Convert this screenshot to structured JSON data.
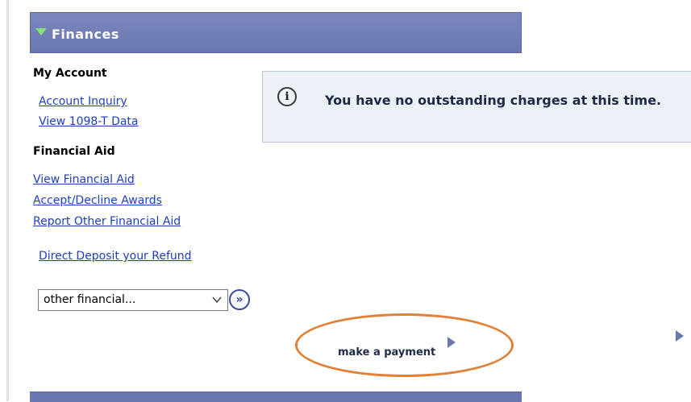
{
  "section": {
    "title": "Finances"
  },
  "my_account": {
    "heading": "My Account",
    "links": [
      "Account Inquiry",
      "View 1098-T Data"
    ]
  },
  "financial_aid": {
    "heading": "Financial Aid",
    "links": [
      "View Financial Aid",
      "Accept/Decline Awards",
      "Report Other Financial Aid"
    ]
  },
  "refund_link": "Direct Deposit your Refund",
  "other_select": {
    "value": "other financial...",
    "go_label": "»"
  },
  "notice": {
    "message": "You have no outstanding charges at this time."
  },
  "payment": {
    "label": "make a payment"
  },
  "icons": {
    "header": "triangle-down-icon",
    "notice": "info-icon",
    "select": "chevron-down-icon",
    "go": "double-chevron-right-icon",
    "payment_arrow": "triangle-right-icon"
  },
  "colors": {
    "header_bg": "#6a77b0",
    "header_triangle": "#7fe07c",
    "link": "#1f3fb8",
    "notice_bg": "#ecf1f7",
    "highlight": "#e08137"
  }
}
